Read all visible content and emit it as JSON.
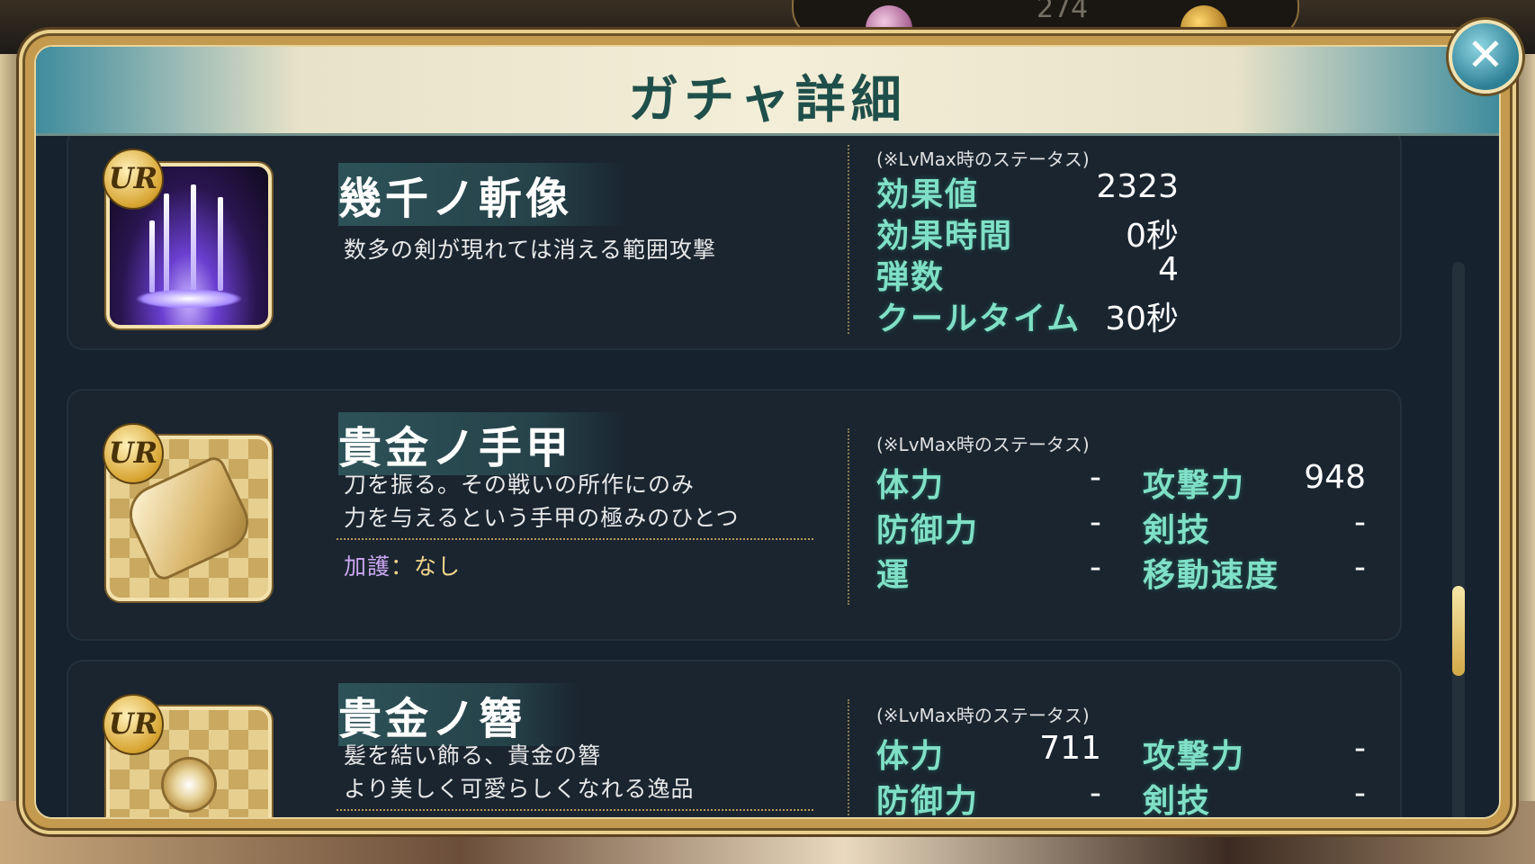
{
  "header": {
    "title": "ガチャ詳細"
  },
  "close_label": "✕",
  "background": {
    "counter": "274"
  },
  "colors": {
    "accent_teal": "#7fe0c5",
    "gold": "#f0d68a",
    "header_text": "#1f4f4a"
  },
  "items": [
    {
      "rarity": "UR",
      "name": "幾千ノ斬像",
      "description": [
        "数多の剣が現れては消える範囲攻撃"
      ],
      "icon": "swords-skill-icon",
      "stat_note": "(※LvMax時のステータス)",
      "stats": [
        {
          "label": "効果値",
          "value": "2323"
        },
        {
          "label": "効果時間",
          "value": "0秒"
        },
        {
          "label": "弾数",
          "value": "4"
        },
        {
          "label": "クールタイム",
          "value": "30秒"
        }
      ]
    },
    {
      "rarity": "UR",
      "name": "貴金ノ手甲",
      "description": [
        "刀を振る。その戦いの所作にのみ",
        "力を与えるという手甲の極みのひとつ"
      ],
      "blessing_label": "加護",
      "blessing_sep": "：",
      "blessing_value": "なし",
      "icon": "gauntlet-icon",
      "stat_note": "(※LvMax時のステータス)",
      "stats_left": [
        {
          "label": "体力",
          "value": "-"
        },
        {
          "label": "防御力",
          "value": "-"
        },
        {
          "label": "運",
          "value": "-"
        }
      ],
      "stats_right": [
        {
          "label": "攻撃力",
          "value": "948"
        },
        {
          "label": "剣技",
          "value": "-"
        },
        {
          "label": "移動速度",
          "value": "-"
        }
      ]
    },
    {
      "rarity": "UR",
      "name": "貴金ノ簪",
      "description": [
        "髪を結い飾る、貴金の簪",
        "より美しく可愛らしくなれる逸品"
      ],
      "icon": "hairpin-icon",
      "stat_note": "(※LvMax時のステータス)",
      "stats_left": [
        {
          "label": "体力",
          "value": "711"
        },
        {
          "label": "防御力",
          "value": "-"
        }
      ],
      "stats_right": [
        {
          "label": "攻撃力",
          "value": "-"
        },
        {
          "label": "剣技",
          "value": "-"
        }
      ]
    }
  ]
}
